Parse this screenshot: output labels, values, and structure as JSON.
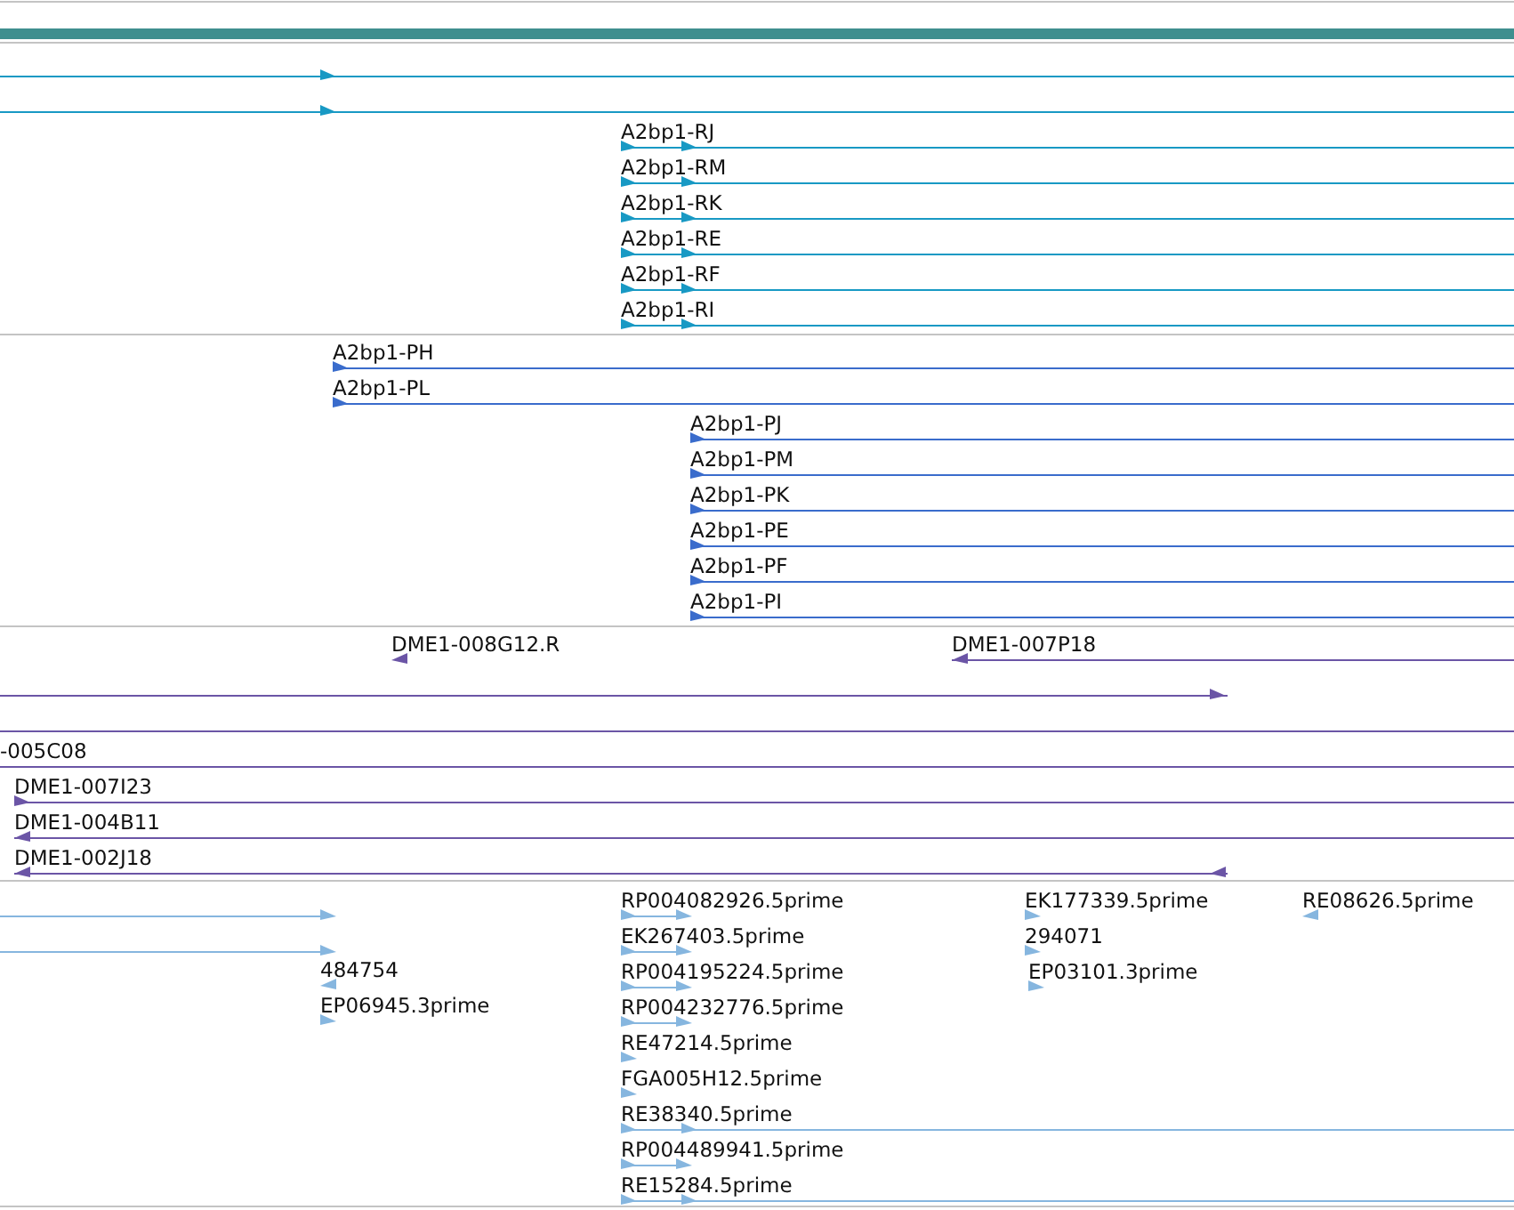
{
  "tracks": [
    {
      "color": "#1899c4",
      "features": [
        {
          "kind": "forward"
        },
        {
          "kind": "forward"
        },
        {
          "label": "A2bp1-RJ",
          "kind": "forward"
        },
        {
          "label": "A2bp1-RM",
          "kind": "forward"
        },
        {
          "label": "A2bp1-RK",
          "kind": "forward"
        },
        {
          "label": "A2bp1-RE",
          "kind": "forward"
        },
        {
          "label": "A2bp1-RF",
          "kind": "forward"
        },
        {
          "label": "A2bp1-RI",
          "kind": "forward"
        }
      ]
    },
    {
      "color": "#3a6ccc",
      "features": [
        {
          "label": "A2bp1-PH",
          "kind": "forward"
        },
        {
          "label": "A2bp1-PL",
          "kind": "forward"
        },
        {
          "label": "A2bp1-PJ",
          "kind": "forward"
        },
        {
          "label": "A2bp1-PM",
          "kind": "forward"
        },
        {
          "label": "A2bp1-PK",
          "kind": "forward"
        },
        {
          "label": "A2bp1-PE",
          "kind": "forward"
        },
        {
          "label": "A2bp1-PF",
          "kind": "forward"
        },
        {
          "label": "A2bp1-PI",
          "kind": "forward"
        }
      ]
    },
    {
      "color": "#6b55a6",
      "features": [
        {
          "label": "DME1-008G12.R",
          "kind": "reverse"
        },
        {
          "label": "DME1-007P18",
          "kind": "reverse"
        },
        {
          "kind": "forward"
        },
        {
          "kind": "plain"
        },
        {
          "label": "-005C08",
          "kind": "plain"
        },
        {
          "label": "DME1-007I23",
          "kind": "forward"
        },
        {
          "label": "DME1-004B11",
          "kind": "reverse"
        },
        {
          "label": "DME1-002J18",
          "kind": "reverse"
        }
      ]
    },
    {
      "color": "#86b6df",
      "features": [
        {
          "kind": "forward"
        },
        {
          "kind": "forward"
        },
        {
          "label": "484754",
          "kind": "reverse"
        },
        {
          "label": "EP06945.3prime",
          "kind": "forward"
        },
        {
          "label": "RP004082926.5prime",
          "kind": "forward"
        },
        {
          "label": "EK267403.5prime",
          "kind": "forward"
        },
        {
          "label": "RP004195224.5prime",
          "kind": "forward"
        },
        {
          "label": "RP004232776.5prime",
          "kind": "forward"
        },
        {
          "label": "RE47214.5prime",
          "kind": "forward"
        },
        {
          "label": "FGA005H12.5prime",
          "kind": "forward"
        },
        {
          "label": "RE38340.5prime",
          "kind": "forward"
        },
        {
          "label": "RP004489941.5prime",
          "kind": "forward"
        },
        {
          "label": "RE15284.5prime",
          "kind": "forward"
        },
        {
          "label": "EK177339.5prime",
          "kind": "forward"
        },
        {
          "label": "294071",
          "kind": "forward"
        },
        {
          "label": "EP03101.3prime",
          "kind": "forward"
        },
        {
          "label": "RE08626.5prime",
          "kind": "reverse"
        }
      ]
    }
  ]
}
